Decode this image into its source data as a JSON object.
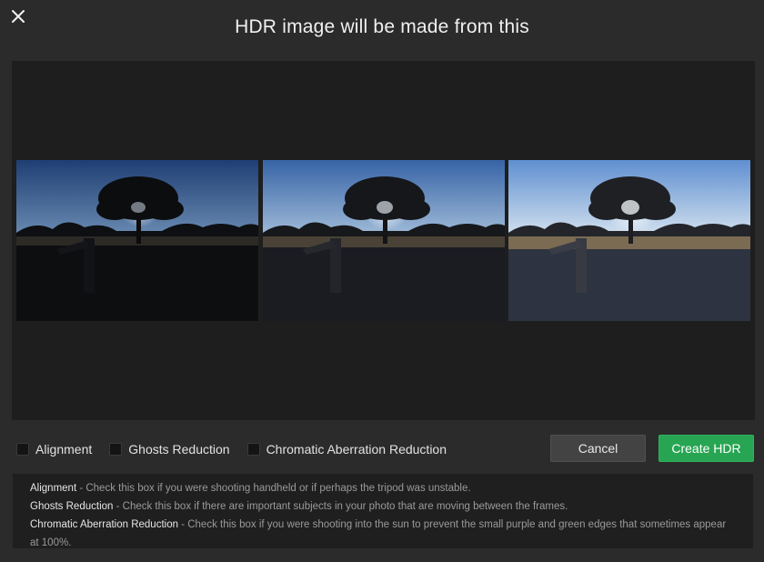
{
  "dialog": {
    "title": "HDR image will be made from this",
    "close_icon": "close-icon"
  },
  "frames": [
    {
      "name": "frame-1",
      "exposure": "dark"
    },
    {
      "name": "frame-2",
      "exposure": "medium"
    },
    {
      "name": "frame-3",
      "exposure": "bright"
    }
  ],
  "options": [
    {
      "id": "alignment",
      "label": "Alignment",
      "checked": false
    },
    {
      "id": "ghosts",
      "label": "Ghosts Reduction",
      "checked": false
    },
    {
      "id": "chromatic",
      "label": "Chromatic Aberration Reduction",
      "checked": false
    }
  ],
  "buttons": {
    "cancel_label": "Cancel",
    "create_label": "Create HDR"
  },
  "help": [
    {
      "term": "Alignment",
      "text": " - Check this box if you were shooting handheld or if perhaps the tripod was unstable."
    },
    {
      "term": "Ghosts Reduction",
      "text": " - Check this box if there are important subjects in your photo that are moving between the frames."
    },
    {
      "term": "Chromatic Aberration Reduction",
      "text": " - Check this box if you were shooting into the sun to prevent the small purple and green edges that sometimes appear at 100%."
    }
  ],
  "colors": {
    "background": "#2b2b2b",
    "preview_bg": "#1e1e1e",
    "accent_green": "#27a552",
    "cancel_bg": "#434343"
  }
}
